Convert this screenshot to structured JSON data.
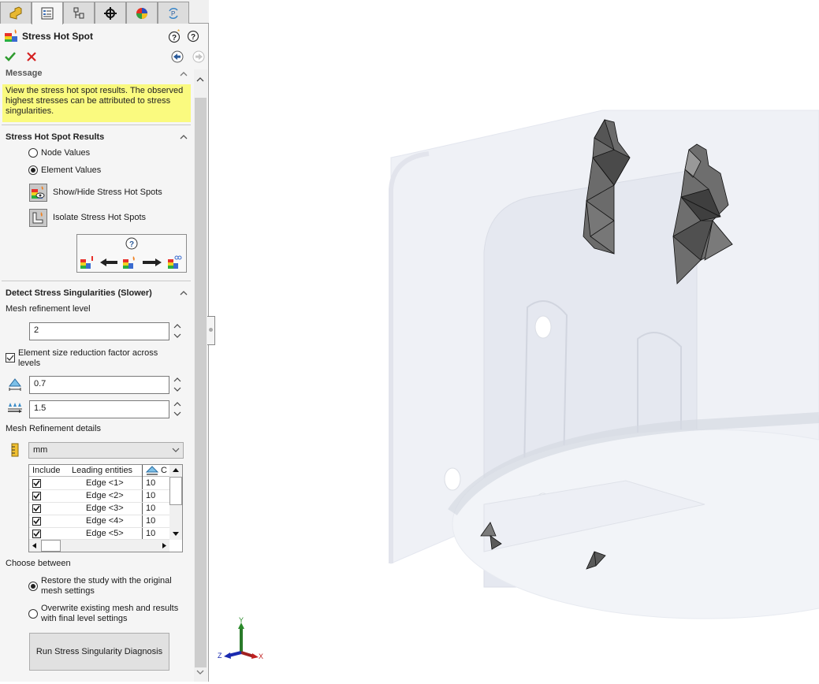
{
  "tabs": [
    {
      "name": "feature-manager",
      "icon": "part-icon"
    },
    {
      "name": "property-manager",
      "icon": "property-manager-icon"
    },
    {
      "name": "configuration-manager",
      "icon": "configuration-icon"
    },
    {
      "name": "dimxpert-manager",
      "icon": "crosshair-icon"
    },
    {
      "name": "display-manager",
      "icon": "appearance-icon"
    },
    {
      "name": "cam-manager",
      "icon": "rotate-p-icon"
    }
  ],
  "header": {
    "title": "Stress Hot Spot",
    "ok": "OK",
    "cancel": "Cancel"
  },
  "message": {
    "title": "Message",
    "text": "View the stress hot spot results. The observed highest stresses can be attributed to stress singularities."
  },
  "results": {
    "title": "Stress Hot Spot Results",
    "options": [
      {
        "label": "Node Values",
        "selected": false
      },
      {
        "label": "Element Values",
        "selected": true
      }
    ],
    "show_hide_label": "Show/Hide Stress Hot Spots",
    "isolate_label": "Isolate Stress Hot Spots",
    "diagram_help": "?"
  },
  "detect": {
    "title": "Detect Stress Singularities (Slower)",
    "mesh_level_label": "Mesh refinement level",
    "mesh_level_value": "2",
    "reduction_checkbox_label": "Element size reduction factor across levels",
    "reduction_checked": true,
    "size_factor_value": "0.7",
    "growth_factor_value": "1.5",
    "details_label": "Mesh Refinement details",
    "unit": "mm",
    "table": {
      "columns": [
        "Include",
        "Leading entities",
        "C"
      ],
      "rows": [
        {
          "include": true,
          "entity": "Edge <1>",
          "value": "10"
        },
        {
          "include": true,
          "entity": "Edge <2>",
          "value": "10"
        },
        {
          "include": true,
          "entity": "Edge <3>",
          "value": "10"
        },
        {
          "include": true,
          "entity": "Edge <4>",
          "value": "10"
        },
        {
          "include": true,
          "entity": "Edge <5>",
          "value": "10"
        }
      ]
    },
    "choose_label": "Choose between",
    "choices": [
      {
        "label": "Restore the study with the original mesh settings",
        "selected": true
      },
      {
        "label": "Overwrite existing mesh and results with final level settings",
        "selected": false
      }
    ],
    "run_button": "Run Stress Singularity Diagnosis"
  },
  "triad": {
    "x": "X",
    "y": "Y",
    "z": "Z"
  },
  "colors": {
    "accent_ok": "#2e9b2e",
    "accent_cancel": "#d52020",
    "message_bg": "#fafa7f"
  }
}
